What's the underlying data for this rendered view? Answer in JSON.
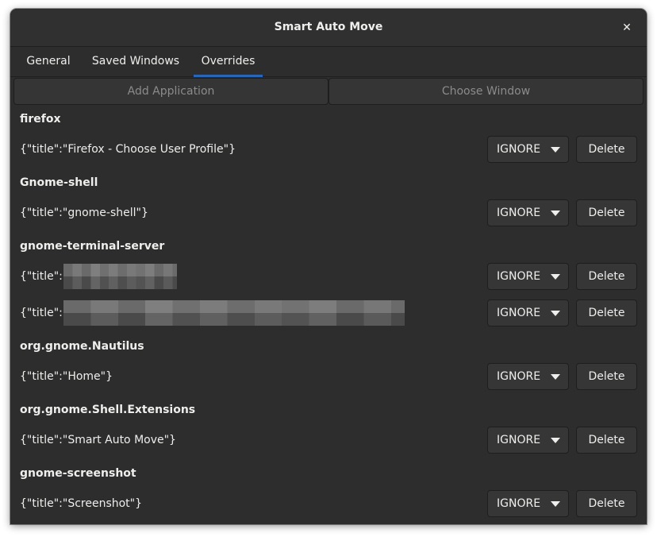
{
  "window": {
    "title": "Smart Auto Move",
    "close_icon": "close-icon"
  },
  "tabs": [
    {
      "label": "General",
      "active": false
    },
    {
      "label": "Saved Windows",
      "active": false
    },
    {
      "label": "Overrides",
      "active": true
    }
  ],
  "accent_color": "#2a66b8",
  "toolbar": {
    "add_application": "Add Application",
    "choose_window": "Choose Window"
  },
  "groups": [
    {
      "name": "firefox",
      "rows": [
        {
          "prefix": "{\"title\":\"Firefox - Choose User Profile\"}",
          "action": "IGNORE",
          "delete": "Delete"
        }
      ]
    },
    {
      "name": "Gnome-shell",
      "rows": [
        {
          "prefix": "{\"title\":\"gnome-shell\"}",
          "action": "IGNORE",
          "delete": "Delete"
        }
      ]
    },
    {
      "name": "gnome-terminal-server",
      "rows": [
        {
          "prefix": "{\"title\":",
          "redacted": true,
          "action": "IGNORE",
          "delete": "Delete"
        },
        {
          "prefix": "{\"title\":",
          "redacted": true,
          "action": "IGNORE",
          "delete": "Delete"
        }
      ]
    },
    {
      "name": "org.gnome.Nautilus",
      "rows": [
        {
          "prefix": "{\"title\":\"Home\"}",
          "action": "IGNORE",
          "delete": "Delete"
        }
      ]
    },
    {
      "name": "org.gnome.Shell.Extensions",
      "rows": [
        {
          "prefix": "{\"title\":\"Smart Auto Move\"}",
          "action": "IGNORE",
          "delete": "Delete"
        }
      ]
    },
    {
      "name": "gnome-screenshot",
      "rows": [
        {
          "prefix": "{\"title\":\"Screenshot\"}",
          "action": "IGNORE",
          "delete": "Delete"
        }
      ]
    }
  ]
}
